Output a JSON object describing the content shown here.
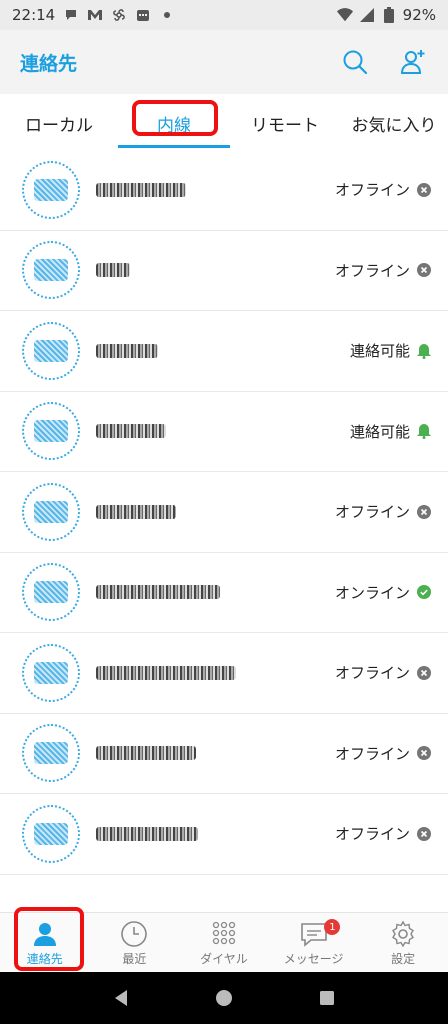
{
  "status_bar": {
    "time": "22:14",
    "battery": "92%"
  },
  "header": {
    "title": "連絡先"
  },
  "tabs": [
    {
      "label": "ローカル",
      "active": false
    },
    {
      "label": "内線",
      "active": true
    },
    {
      "label": "リモート",
      "active": false
    },
    {
      "label": "お気に入り",
      "active": false
    }
  ],
  "contacts": [
    {
      "status": "オフライン",
      "status_icon": "offline-icon"
    },
    {
      "status": "オフライン",
      "status_icon": "offline-icon"
    },
    {
      "status": "連絡可能",
      "status_icon": "bell-icon"
    },
    {
      "status": "連絡可能",
      "status_icon": "bell-icon"
    },
    {
      "status": "オフライン",
      "status_icon": "offline-icon"
    },
    {
      "status": "オンライン",
      "status_icon": "online-check-icon"
    },
    {
      "status": "オフライン",
      "status_icon": "offline-icon"
    },
    {
      "status": "オフライン",
      "status_icon": "offline-icon"
    },
    {
      "status": "オフライン",
      "status_icon": "offline-icon"
    }
  ],
  "bottom_nav": [
    {
      "label": "連絡先",
      "icon": "contacts-icon",
      "active": true
    },
    {
      "label": "最近",
      "icon": "clock-icon",
      "active": false
    },
    {
      "label": "ダイヤル",
      "icon": "dialpad-icon",
      "active": false
    },
    {
      "label": "メッセージ",
      "icon": "message-icon",
      "active": false,
      "badge": "1"
    },
    {
      "label": "設定",
      "icon": "gear-icon",
      "active": false
    }
  ],
  "colors": {
    "accent": "#1a9fe0",
    "online": "#4caf50",
    "offline": "#757575",
    "highlight_box": "#ee1111"
  }
}
